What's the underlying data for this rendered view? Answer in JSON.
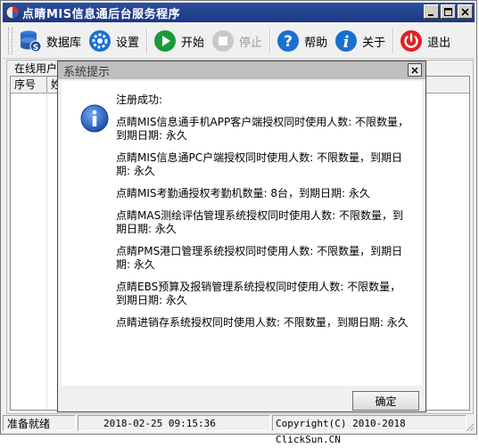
{
  "window": {
    "title": "点睛MIS信息通后台服务程序",
    "buttons": [
      "minimize",
      "maximize",
      "close"
    ]
  },
  "toolbar": {
    "items": [
      {
        "label": "数据库",
        "icon": "database-icon",
        "enabled": true
      },
      {
        "label": "设置",
        "icon": "gear-icon",
        "enabled": true
      },
      {
        "label": "开始",
        "icon": "play-icon",
        "enabled": true
      },
      {
        "label": "停止",
        "icon": "stop-icon",
        "enabled": false
      },
      {
        "label": "帮助",
        "icon": "help-icon",
        "enabled": true
      },
      {
        "label": "关于",
        "icon": "info-icon",
        "enabled": true
      },
      {
        "label": "退出",
        "icon": "power-icon",
        "enabled": true
      }
    ]
  },
  "online_users": {
    "group_label": "在线用户",
    "columns": [
      "序号",
      "姓"
    ]
  },
  "dialog": {
    "title": "系统提示",
    "lines": [
      "注册成功:",
      "点睛MIS信息通手机APP客户端授权同时使用人数: 不限数量，到期日期: 永久",
      "点睛MIS信息通PC户端授权同时使用人数: 不限数量，到期日期: 永久",
      "点睛MIS考勤通授权考勤机数量: 8台，到期日期: 永久",
      "点睛MAS测绘评估管理系统授权同时使用人数: 不限数量，到期日期: 永久",
      "点睛PMS港口管理系统授权同时使用人数: 不限数量，到期日期: 永久",
      "点睛EBS预算及报销管理系统授权同时使用人数: 不限数量，到期日期: 永久",
      "点睛进销存系统授权同时使用人数: 不限数量，到期日期: 永久"
    ],
    "ok_label": "确定"
  },
  "statusbar": {
    "status": "准备就绪",
    "datetime": "2018-02-25 09:15:36",
    "copyright": "Copyright(C) 2010-2018 ClickSun.CN"
  },
  "colors": {
    "titlebar": "#1f3d8c",
    "accent_blue": "#1a6fd0",
    "play_green": "#1a9a3a",
    "power_red": "#e02020"
  }
}
